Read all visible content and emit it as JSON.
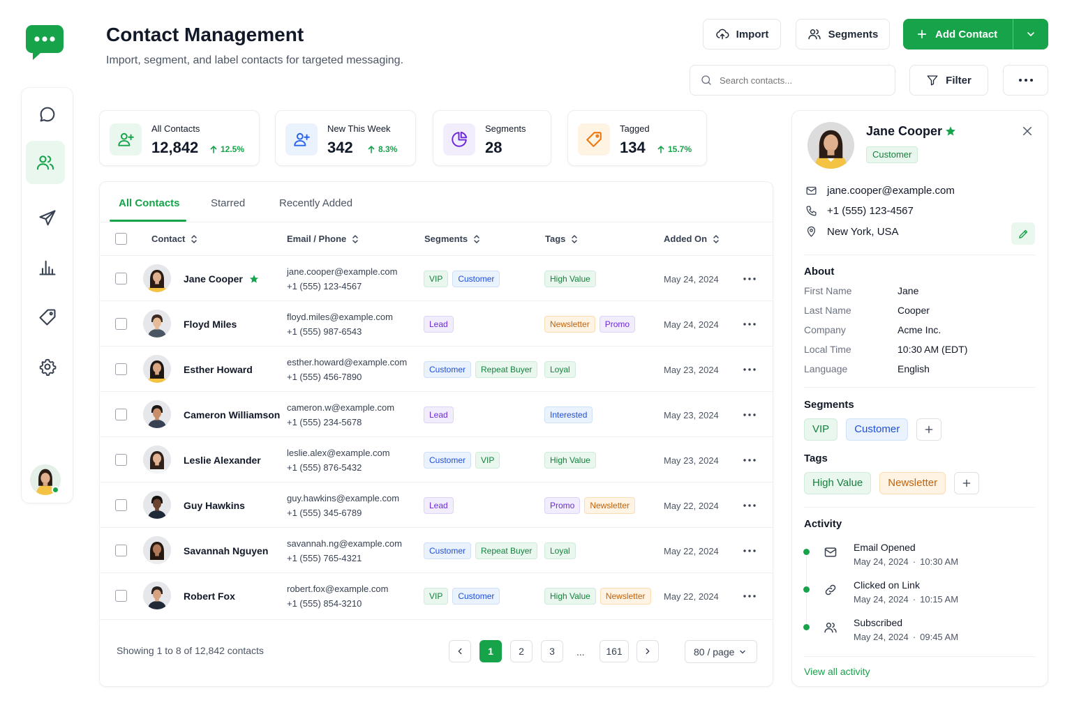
{
  "header": {
    "title": "Contact Management",
    "subtitle": "Import, segment, and label contacts for targeted messaging."
  },
  "actions": {
    "import": "Import",
    "segments": "Segments",
    "add_contact": "Add Contact",
    "filter": "Filter"
  },
  "search": {
    "placeholder": "Search contacts..."
  },
  "stats": [
    {
      "label": "All Contacts",
      "value": "12,842",
      "change": "12.5%"
    },
    {
      "label": "New This Week",
      "value": "342",
      "change": "8.3%"
    },
    {
      "label": "Segments",
      "value": "28"
    },
    {
      "label": "Tagged",
      "value": "134",
      "change": "15.7%"
    }
  ],
  "tabs": [
    "All Contacts",
    "Starred",
    "Recently Added"
  ],
  "table": {
    "columns": [
      "Contact",
      "Email / Phone",
      "Segments",
      "Tags",
      "Added On"
    ],
    "rows": [
      {
        "name": "Jane Cooper",
        "starred": true,
        "email": "jane.cooper@example.com",
        "phone": "+1 (555) 123-4567",
        "segments": [
          {
            "t": "VIP",
            "c": "green"
          },
          {
            "t": "Customer",
            "c": "blue"
          }
        ],
        "tags": [
          {
            "t": "High Value",
            "c": "green"
          }
        ],
        "added": "May 24, 2024"
      },
      {
        "name": "Floyd Miles",
        "starred": false,
        "email": "floyd.miles@example.com",
        "phone": "+1 (555) 987-6543",
        "segments": [
          {
            "t": "Lead",
            "c": "purple"
          }
        ],
        "tags": [
          {
            "t": "Newsletter",
            "c": "orange"
          },
          {
            "t": "Promo",
            "c": "purple"
          }
        ],
        "added": "May 24, 2024"
      },
      {
        "name": "Esther Howard",
        "starred": false,
        "email": "esther.howard@example.com",
        "phone": "+1 (555) 456-7890",
        "segments": [
          {
            "t": "Customer",
            "c": "blue"
          },
          {
            "t": "Repeat Buyer",
            "c": "green"
          }
        ],
        "tags": [
          {
            "t": "Loyal",
            "c": "green"
          }
        ],
        "added": "May 23, 2024"
      },
      {
        "name": "Cameron Williamson",
        "starred": false,
        "email": "cameron.w@example.com",
        "phone": "+1 (555) 234-5678",
        "segments": [
          {
            "t": "Lead",
            "c": "purple"
          }
        ],
        "tags": [
          {
            "t": "Interested",
            "c": "blue"
          }
        ],
        "added": "May 23, 2024"
      },
      {
        "name": "Leslie Alexander",
        "starred": false,
        "email": "leslie.alex@example.com",
        "phone": "+1 (555) 876-5432",
        "segments": [
          {
            "t": "Customer",
            "c": "blue"
          },
          {
            "t": "VIP",
            "c": "green"
          }
        ],
        "tags": [
          {
            "t": "High Value",
            "c": "green"
          }
        ],
        "added": "May 23, 2024"
      },
      {
        "name": "Guy Hawkins",
        "starred": false,
        "email": "guy.hawkins@example.com",
        "phone": "+1 (555) 345-6789",
        "segments": [
          {
            "t": "Lead",
            "c": "purple"
          }
        ],
        "tags": [
          {
            "t": "Promo",
            "c": "purple"
          },
          {
            "t": "Newsletter",
            "c": "orange"
          }
        ],
        "added": "May 22, 2024"
      },
      {
        "name": "Savannah Nguyen",
        "starred": false,
        "email": "savannah.ng@example.com",
        "phone": "+1 (555) 765-4321",
        "segments": [
          {
            "t": "Customer",
            "c": "blue"
          },
          {
            "t": "Repeat Buyer",
            "c": "green"
          }
        ],
        "tags": [
          {
            "t": "Loyal",
            "c": "green"
          }
        ],
        "added": "May 22, 2024"
      },
      {
        "name": "Robert Fox",
        "starred": false,
        "email": "robert.fox@example.com",
        "phone": "+1 (555) 854-3210",
        "segments": [
          {
            "t": "VIP",
            "c": "green"
          },
          {
            "t": "Customer",
            "c": "blue"
          }
        ],
        "tags": [
          {
            "t": "High Value",
            "c": "green"
          },
          {
            "t": "Newsletter",
            "c": "orange"
          }
        ],
        "added": "May 22, 2024"
      }
    ]
  },
  "footer": {
    "showing": "Showing 1 to 8 of 12,842 contacts",
    "pages": [
      "1",
      "2",
      "3",
      "...",
      "161"
    ],
    "per_page": "80 / page"
  },
  "detail": {
    "name": "Jane Cooper",
    "badge": "Customer",
    "email": "jane.cooper@example.com",
    "phone": "+1 (555) 123-4567",
    "location": "New York, USA",
    "about_title": "About",
    "about": [
      [
        "First Name",
        "Jane"
      ],
      [
        "Last Name",
        "Cooper"
      ],
      [
        "Company",
        "Acme Inc."
      ],
      [
        "Local Time",
        "10:30 AM (EDT)"
      ],
      [
        "Language",
        "English"
      ]
    ],
    "segments_title": "Segments",
    "segments": [
      "VIP",
      "Customer"
    ],
    "tags_title": "Tags",
    "tags": [
      "High Value",
      "Newsletter"
    ],
    "activity_title": "Activity",
    "activity": [
      {
        "title": "Email Opened",
        "date": "May 24, 2024",
        "time": "10:30 AM"
      },
      {
        "title": "Clicked on Link",
        "date": "May 24, 2024",
        "time": "10:15 AM"
      },
      {
        "title": "Subscribed",
        "date": "May 24, 2024",
        "time": "09:45 AM"
      }
    ],
    "view_all": "View all activity"
  },
  "colors": {
    "accent": "#16A34A",
    "accent_dark": "#15803D"
  }
}
